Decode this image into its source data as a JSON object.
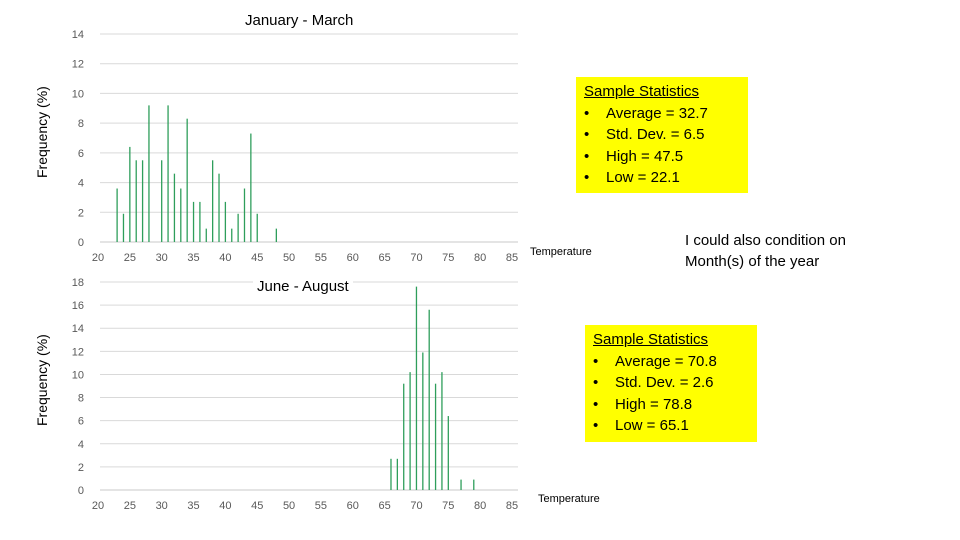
{
  "chart_data": [
    {
      "type": "bar",
      "title": "January - March",
      "xlabel": "Temperature",
      "ylabel": "Frequency (%)",
      "xlim": [
        20,
        85
      ],
      "ylim": [
        0,
        14
      ],
      "xticks": [
        20,
        25,
        30,
        35,
        40,
        45,
        50,
        55,
        60,
        65,
        70,
        75,
        80,
        85
      ],
      "yticks": [
        0,
        2,
        4,
        6,
        8,
        10,
        12,
        14
      ],
      "grid": true,
      "color": "#2e9e5b",
      "x": [
        23,
        24,
        25,
        26,
        27,
        28,
        30,
        31,
        32,
        33,
        34,
        35,
        36,
        37,
        38,
        39,
        40,
        41,
        42,
        43,
        44,
        45,
        48
      ],
      "values": [
        3.6,
        1.9,
        6.4,
        5.5,
        5.5,
        9.2,
        5.5,
        9.2,
        4.6,
        3.6,
        8.3,
        2.7,
        2.7,
        0.9,
        5.5,
        4.6,
        2.7,
        0.9,
        1.9,
        3.6,
        7.3,
        1.9,
        0.9
      ],
      "stats": {
        "heading": "Sample Statistics",
        "items": [
          "Average = 32.7",
          "Std. Dev. = 6.5",
          "High = 47.5",
          "Low = 22.1"
        ]
      }
    },
    {
      "type": "bar",
      "title": "June - August",
      "xlabel": "Temperature",
      "ylabel": "Frequency (%)",
      "xlim": [
        20,
        85
      ],
      "ylim": [
        0,
        18
      ],
      "xticks": [
        20,
        25,
        30,
        35,
        40,
        45,
        50,
        55,
        60,
        65,
        70,
        75,
        80,
        85
      ],
      "yticks": [
        0,
        2,
        4,
        6,
        8,
        10,
        12,
        14,
        16,
        18
      ],
      "grid": true,
      "color": "#2e9e5b",
      "x": [
        66,
        67,
        68,
        69,
        70,
        71,
        72,
        73,
        74,
        75,
        77,
        79
      ],
      "values": [
        2.7,
        2.7,
        9.2,
        10.2,
        17.6,
        11.9,
        15.6,
        9.2,
        10.2,
        6.4,
        0.9,
        0.9
      ],
      "stats": {
        "heading": "Sample Statistics",
        "items": [
          "Average = 70.8",
          "Std. Dev. = 2.6",
          "High = 78.8",
          "Low = 65.1"
        ]
      }
    }
  ],
  "note": {
    "line1": "I could also condition on",
    "line2": "Month(s) of the year"
  },
  "bullet": "•"
}
